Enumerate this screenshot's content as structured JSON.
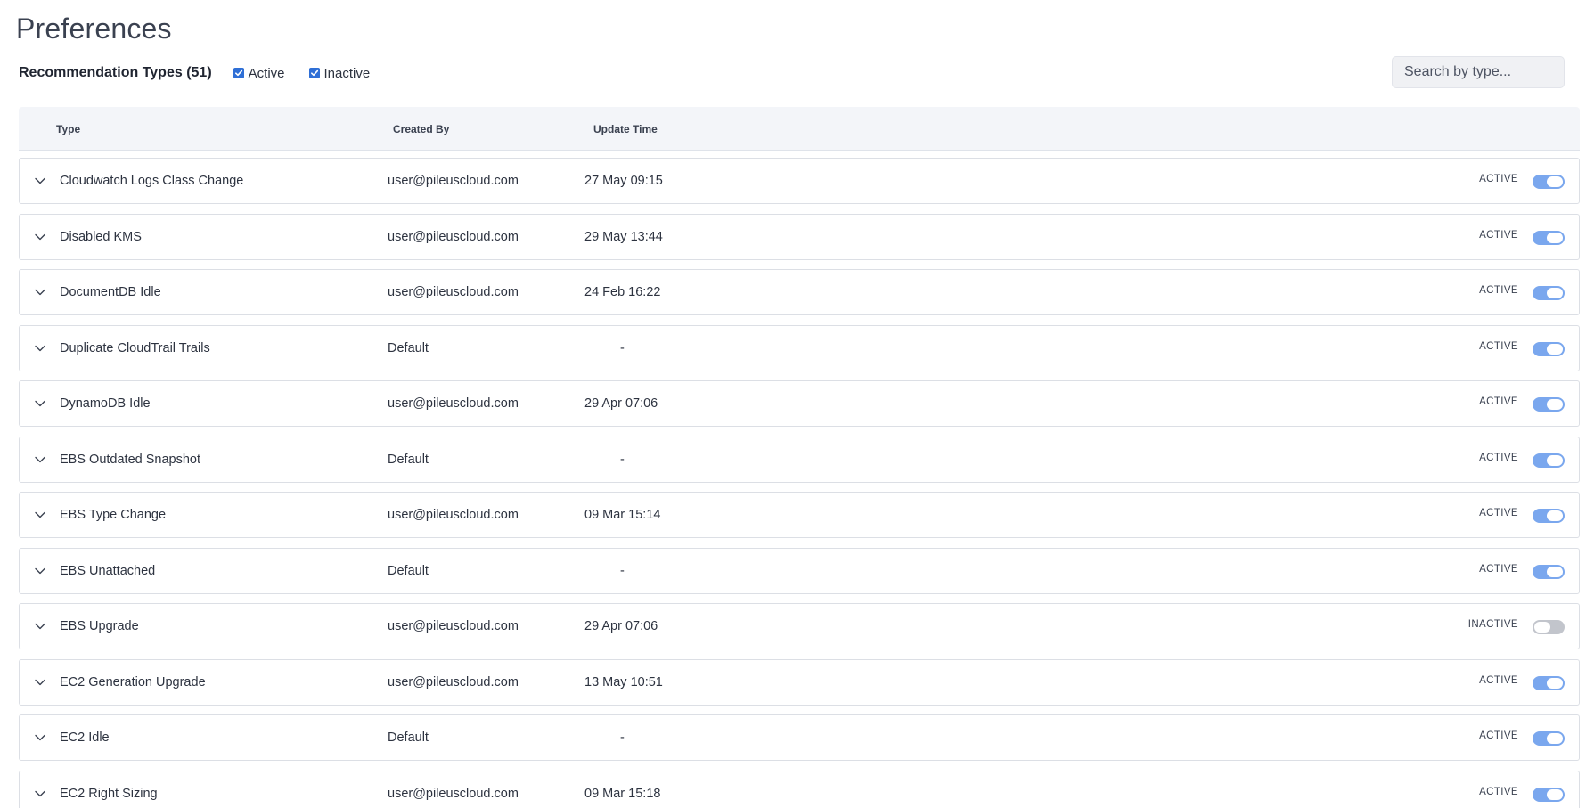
{
  "page": {
    "title": "Preferences"
  },
  "filters": {
    "title": "Recommendation Types (51)",
    "options": [
      {
        "label": "Active",
        "checked": true
      },
      {
        "label": "Inactive",
        "checked": true
      }
    ]
  },
  "search": {
    "placeholder": "Search by type..."
  },
  "table": {
    "columns": {
      "type": "Type",
      "created_by": "Created By",
      "update_time": "Update Time"
    },
    "rows": [
      {
        "type": "Cloudwatch Logs Class Change",
        "created_by": "user@pileuscloud.com",
        "update_time": "27 May 09:15",
        "status": "ACTIVE",
        "enabled": true
      },
      {
        "type": "Disabled KMS",
        "created_by": "user@pileuscloud.com",
        "update_time": "29 May 13:44",
        "status": "ACTIVE",
        "enabled": true
      },
      {
        "type": "DocumentDB Idle",
        "created_by": "user@pileuscloud.com",
        "update_time": "24 Feb 16:22",
        "status": "ACTIVE",
        "enabled": true
      },
      {
        "type": "Duplicate CloudTrail Trails",
        "created_by": "Default",
        "update_time": "-",
        "status": "ACTIVE",
        "enabled": true
      },
      {
        "type": "DynamoDB Idle",
        "created_by": "user@pileuscloud.com",
        "update_time": "29 Apr 07:06",
        "status": "ACTIVE",
        "enabled": true
      },
      {
        "type": "EBS Outdated Snapshot",
        "created_by": "Default",
        "update_time": "-",
        "status": "ACTIVE",
        "enabled": true
      },
      {
        "type": "EBS Type Change",
        "created_by": "user@pileuscloud.com",
        "update_time": "09 Mar 15:14",
        "status": "ACTIVE",
        "enabled": true
      },
      {
        "type": "EBS Unattached",
        "created_by": "Default",
        "update_time": "-",
        "status": "ACTIVE",
        "enabled": true
      },
      {
        "type": "EBS Upgrade",
        "created_by": "user@pileuscloud.com",
        "update_time": "29 Apr 07:06",
        "status": "INACTIVE",
        "enabled": false
      },
      {
        "type": "EC2 Generation Upgrade",
        "created_by": "user@pileuscloud.com",
        "update_time": "13 May 10:51",
        "status": "ACTIVE",
        "enabled": true
      },
      {
        "type": "EC2 Idle",
        "created_by": "Default",
        "update_time": "-",
        "status": "ACTIVE",
        "enabled": true
      },
      {
        "type": "EC2 Right Sizing",
        "created_by": "user@pileuscloud.com",
        "update_time": "09 Mar 15:18",
        "status": "ACTIVE",
        "enabled": true
      }
    ]
  },
  "icons": {
    "row_expand": "chevron-down-icon",
    "checkbox_mark": "check-icon"
  },
  "colors": {
    "accent": "#2f6fd6",
    "toggle_on": "#7aa7ee",
    "toggle_off": "#c2c5cc",
    "header_bg": "#f3f5f9"
  }
}
